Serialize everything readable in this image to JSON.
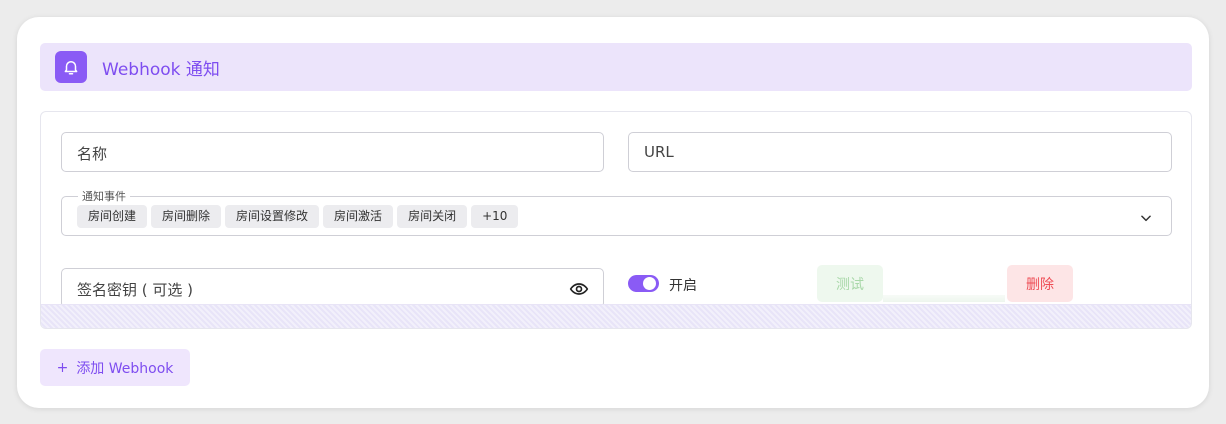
{
  "header": {
    "title": "Webhook 通知",
    "icon": "bell-icon",
    "accent": "#8a5bf5"
  },
  "form": {
    "name_placeholder": "名称",
    "url_placeholder": "URL",
    "events_label": "通知事件",
    "events": [
      "房间创建",
      "房间删除",
      "房间设置修改",
      "房间激活",
      "房间关闭"
    ],
    "events_more": "+10",
    "secret_placeholder": "签名密钥 ( 可选 )",
    "enabled_label": "开启",
    "enabled": true,
    "test_label": "测试",
    "delete_label": "删除"
  },
  "add_button": {
    "plus": "+",
    "label": "添加 Webhook"
  }
}
